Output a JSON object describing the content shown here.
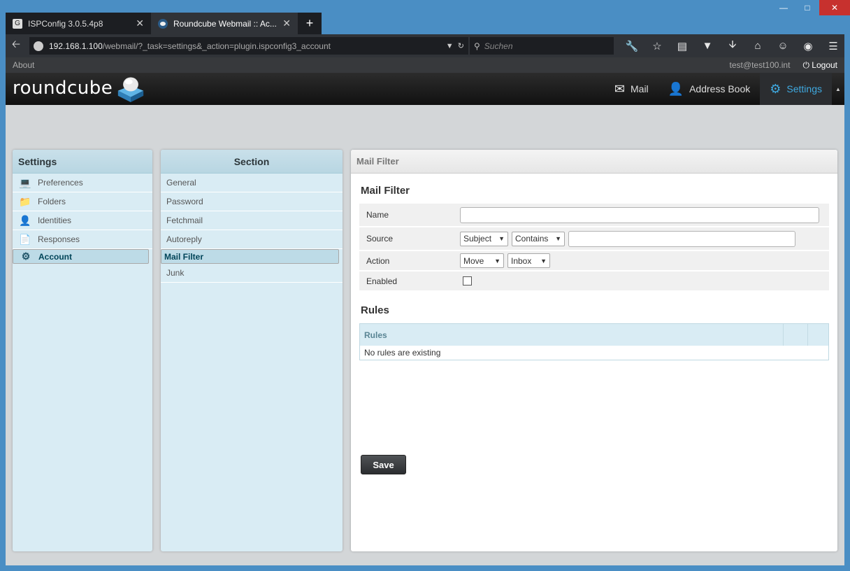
{
  "browser": {
    "tabs": [
      {
        "label": "ISPConfig 3.0.5.4p8",
        "icon": "ispconfig-icon"
      },
      {
        "label": "Roundcube Webmail :: Ac...",
        "icon": "roundcube-icon"
      }
    ],
    "url_base": "192.168.1.100",
    "url_path": "/webmail/?_task=settings&_action=plugin.ispconfig3_account",
    "search_placeholder": "Suchen"
  },
  "topline": {
    "about": "About",
    "user": "test@test100.int",
    "logout": "Logout"
  },
  "header": {
    "logo_text": "roundcube",
    "tasks": [
      {
        "label": "Mail",
        "icon": "envelope-icon"
      },
      {
        "label": "Address Book",
        "icon": "person-icon"
      },
      {
        "label": "Settings",
        "icon": "gear-icon",
        "active": true
      }
    ]
  },
  "settings_panel": {
    "title": "Settings",
    "items": [
      {
        "label": "Preferences",
        "icon": "laptop-icon"
      },
      {
        "label": "Folders",
        "icon": "folder-icon"
      },
      {
        "label": "Identities",
        "icon": "person-icon"
      },
      {
        "label": "Responses",
        "icon": "document-icon"
      },
      {
        "label": "Account",
        "icon": "gear-icon",
        "selected": true
      }
    ]
  },
  "section_panel": {
    "title": "Section",
    "items": [
      {
        "label": "General"
      },
      {
        "label": "Password"
      },
      {
        "label": "Fetchmail"
      },
      {
        "label": "Autoreply"
      },
      {
        "label": "Mail Filter",
        "selected": true
      },
      {
        "label": "Junk"
      }
    ]
  },
  "main": {
    "header": "Mail Filter",
    "form_title": "Mail Filter",
    "fields": {
      "name_label": "Name",
      "source_label": "Source",
      "source_field": "Subject",
      "source_op": "Contains",
      "action_label": "Action",
      "action_type": "Move",
      "action_target": "Inbox",
      "enabled_label": "Enabled"
    },
    "rules_title": "Rules",
    "rules_header": "Rules",
    "rules_empty": "No rules are existing",
    "save_label": "Save"
  }
}
